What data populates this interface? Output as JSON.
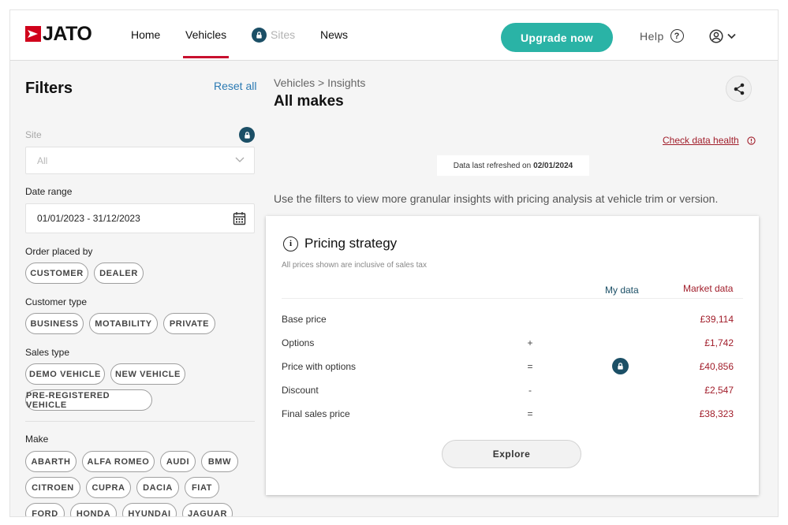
{
  "header": {
    "logo_text": "JATO",
    "nav": [
      {
        "label": "Home"
      },
      {
        "label": "Vehicles"
      },
      {
        "label": "Sites"
      },
      {
        "label": "News"
      }
    ],
    "upgrade_label": "Upgrade now",
    "help_label": "Help"
  },
  "sidebar": {
    "title": "Filters",
    "reset_label": "Reset all",
    "site": {
      "label": "Site",
      "value": "All"
    },
    "date_range": {
      "label": "Date range",
      "value": "01/01/2023 - 31/12/2023"
    },
    "order_placed_by": {
      "label": "Order placed by",
      "chips": [
        "CUSTOMER",
        "DEALER"
      ]
    },
    "customer_type": {
      "label": "Customer type",
      "chips": [
        "BUSINESS",
        "MOTABILITY",
        "PRIVATE"
      ]
    },
    "sales_type": {
      "label": "Sales type",
      "chips": [
        "DEMO VEHICLE",
        "NEW VEHICLE",
        "PRE-REGISTERED VEHICLE"
      ]
    },
    "make": {
      "label": "Make",
      "chips": [
        "ABARTH",
        "ALFA ROMEO",
        "AUDI",
        "BMW",
        "CITROEN",
        "CUPRA",
        "DACIA",
        "FIAT",
        "FORD",
        "HONDA",
        "HYUNDAI",
        "JAGUAR"
      ]
    }
  },
  "main": {
    "breadcrumb": "Vehicles > Insights",
    "title": "All makes",
    "check_health": "Check data health",
    "refreshed_prefix": "Data last refreshed on",
    "refreshed_date": "02/01/2024",
    "intro": "Use the filters to view more granular insights with pricing analysis at vehicle trim or version."
  },
  "pricing": {
    "title": "Pricing strategy",
    "subtitle": "All prices shown are inclusive of sales tax",
    "col_my": "My data",
    "col_market": "Market data",
    "rows": [
      {
        "label": "Base price",
        "op": "",
        "value": "£39,114"
      },
      {
        "label": "Options",
        "op": "+",
        "value": "£1,742"
      },
      {
        "label": "Price with options",
        "op": "=",
        "value": "£40,856"
      },
      {
        "label": "Discount",
        "op": "-",
        "value": "£2,547"
      },
      {
        "label": "Final sales price",
        "op": "=",
        "value": "£38,323"
      }
    ],
    "explore_label": "Explore"
  },
  "colors": {
    "accent_teal": "#2ab3a6",
    "lock_navy": "#1b4f66",
    "brand_red": "#d0021b",
    "market_red": "#a11d2a"
  },
  "icons": [
    "lock-icon",
    "chevron-down-icon",
    "calendar-icon",
    "share-icon",
    "info-icon",
    "help-icon",
    "user-icon"
  ]
}
